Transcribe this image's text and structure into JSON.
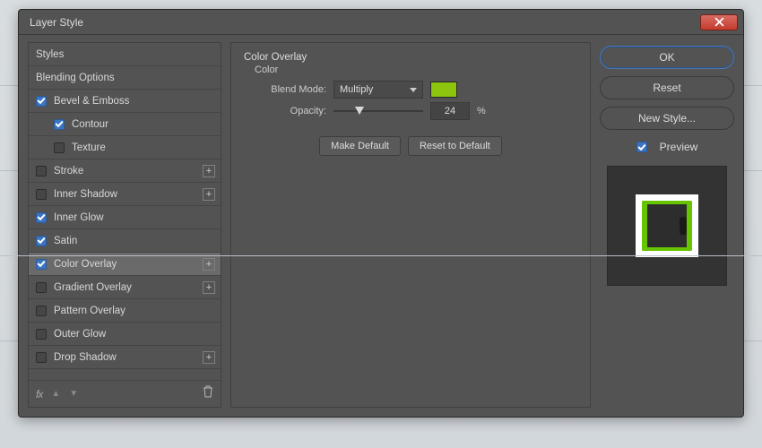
{
  "window": {
    "title": "Layer Style"
  },
  "sidebar": {
    "items": [
      {
        "label": "Styles",
        "checked": null,
        "hasPlus": false,
        "indent": false
      },
      {
        "label": "Blending Options",
        "checked": null,
        "hasPlus": false,
        "indent": false
      },
      {
        "label": "Bevel & Emboss",
        "checked": true,
        "hasPlus": false,
        "indent": false
      },
      {
        "label": "Contour",
        "checked": true,
        "hasPlus": false,
        "indent": true
      },
      {
        "label": "Texture",
        "checked": false,
        "hasPlus": false,
        "indent": true
      },
      {
        "label": "Stroke",
        "checked": false,
        "hasPlus": true,
        "indent": false
      },
      {
        "label": "Inner Shadow",
        "checked": false,
        "hasPlus": true,
        "indent": false
      },
      {
        "label": "Inner Glow",
        "checked": true,
        "hasPlus": false,
        "indent": false
      },
      {
        "label": "Satin",
        "checked": true,
        "hasPlus": false,
        "indent": false
      },
      {
        "label": "Color Overlay",
        "checked": true,
        "hasPlus": true,
        "indent": false,
        "selected": true
      },
      {
        "label": "Gradient Overlay",
        "checked": false,
        "hasPlus": true,
        "indent": false
      },
      {
        "label": "Pattern Overlay",
        "checked": false,
        "hasPlus": false,
        "indent": false
      },
      {
        "label": "Outer Glow",
        "checked": false,
        "hasPlus": false,
        "indent": false
      },
      {
        "label": "Drop Shadow",
        "checked": false,
        "hasPlus": true,
        "indent": false
      }
    ],
    "fx_label": "fx"
  },
  "settings": {
    "group_title": "Color Overlay",
    "group_sub": "Color",
    "blend_mode_label": "Blend Mode:",
    "blend_mode_value": "Multiply",
    "color_swatch": "#8cc40e",
    "opacity_label": "Opacity:",
    "opacity_value": "24",
    "opacity_unit": "%",
    "opacity_slider_pct": 24,
    "make_default": "Make Default",
    "reset_default": "Reset to Default"
  },
  "right": {
    "ok": "OK",
    "reset": "Reset",
    "new_style": "New Style...",
    "preview_label": "Preview",
    "preview_checked": true
  }
}
